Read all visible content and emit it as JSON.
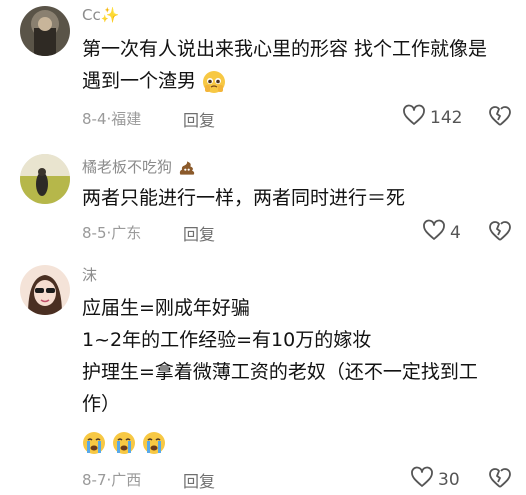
{
  "comments": [
    {
      "username": "Cc",
      "username_suffix": "✨",
      "lines": [
        "第一次有人说出来我心里的形容 找个工作就像是",
        "遇到一个渣男"
      ],
      "date": "8-4",
      "location": "福建",
      "reply_label": "回复",
      "likes": "142"
    },
    {
      "username": "橘老板不吃狗",
      "lines": [
        "两者只能进行一样，两者同时进行＝死"
      ],
      "date": "8-5",
      "location": "广东",
      "reply_label": "回复",
      "likes": "4"
    },
    {
      "username": "沫",
      "lines": [
        "应届生=刚成年好骗",
        "1~2年的工作经验=有10万的嫁妆",
        "护理生=拿着微薄工资的老奴（还不一定找到工",
        "作）"
      ],
      "date": "8-7",
      "location": "广西",
      "reply_label": "回复",
      "likes": "30"
    }
  ],
  "separator": "·",
  "colors": {
    "meta": "#9a9a9a",
    "username": "#8c8c8c",
    "body": "#121212"
  }
}
